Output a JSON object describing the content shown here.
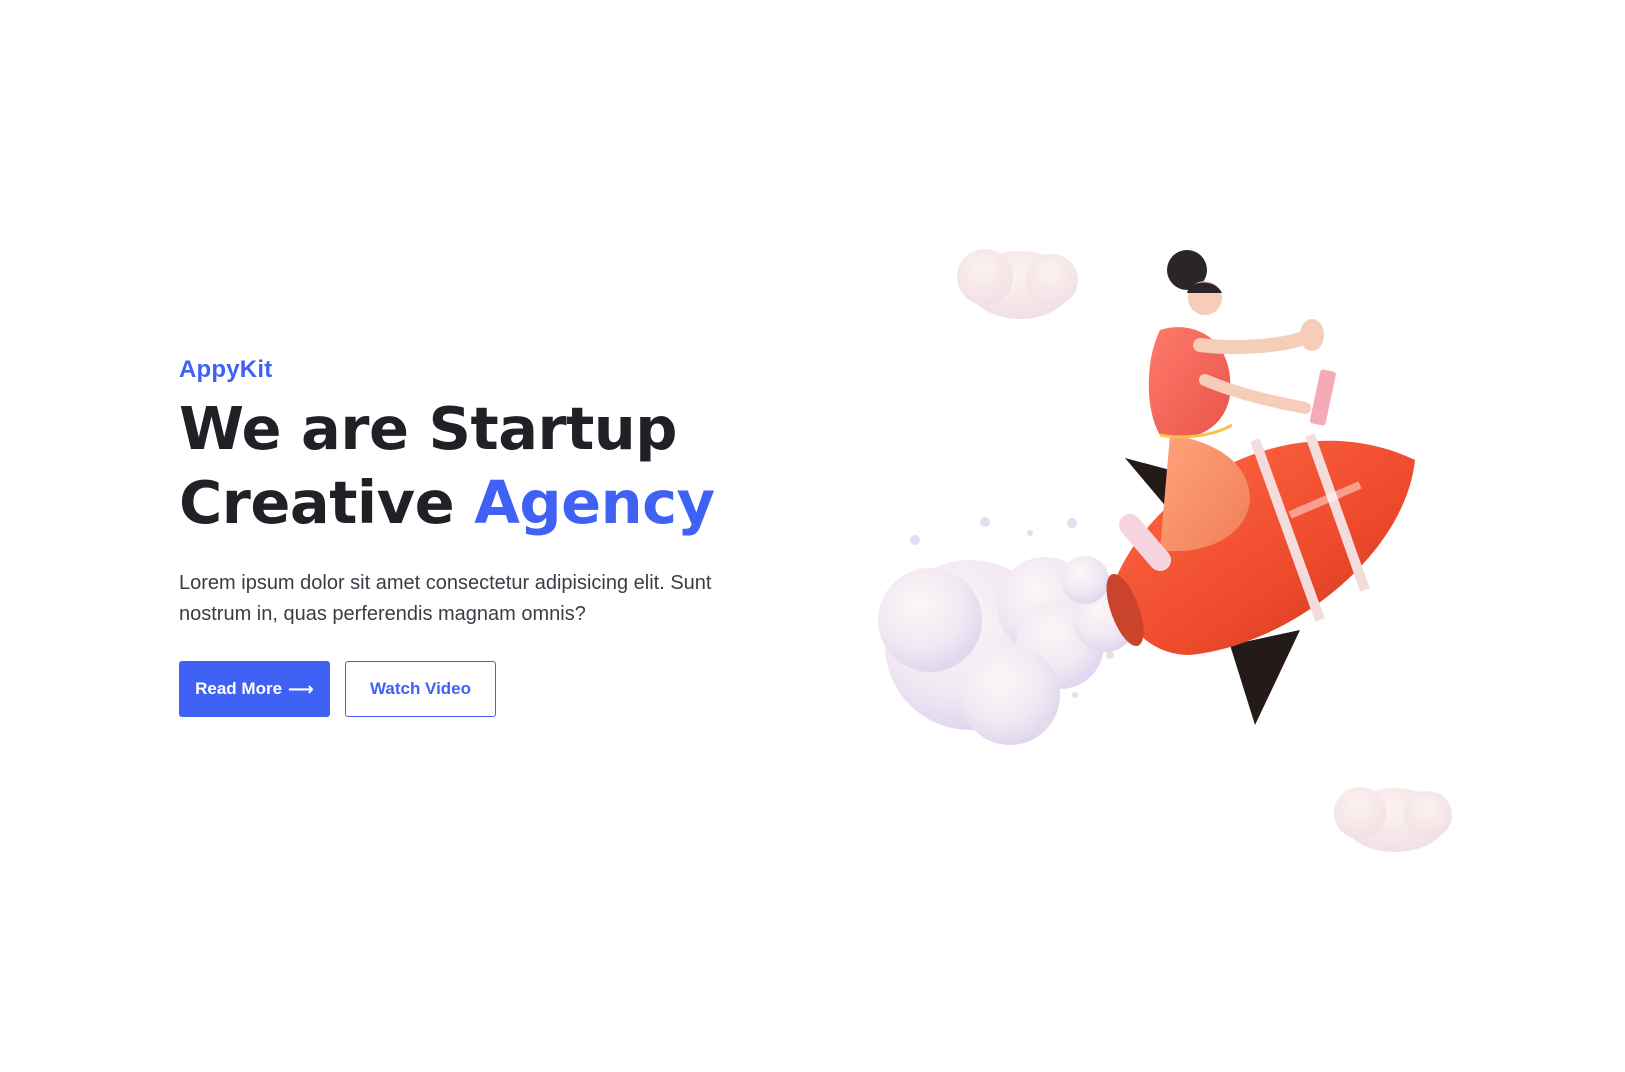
{
  "hero": {
    "eyebrow": "AppyKit",
    "headline_line1": "We are Startup",
    "headline_line2_plain": "Creative",
    "headline_line2_accent": "Agency",
    "description": "Lorem ipsum dolor sit amet consectetur adipisicing elit. Sunt nostrum in, quas perferendis magnam omnis?",
    "primary_button_label": "Read More",
    "primary_button_icon": "arrow-right-icon",
    "secondary_button_label": "Watch Video"
  },
  "illustration": {
    "subject": "rocket-rider-illustration"
  },
  "colors": {
    "accent": "#3f62f5",
    "heading": "#1f2126",
    "body_text": "#3a3d44",
    "background": "#ffffff"
  }
}
